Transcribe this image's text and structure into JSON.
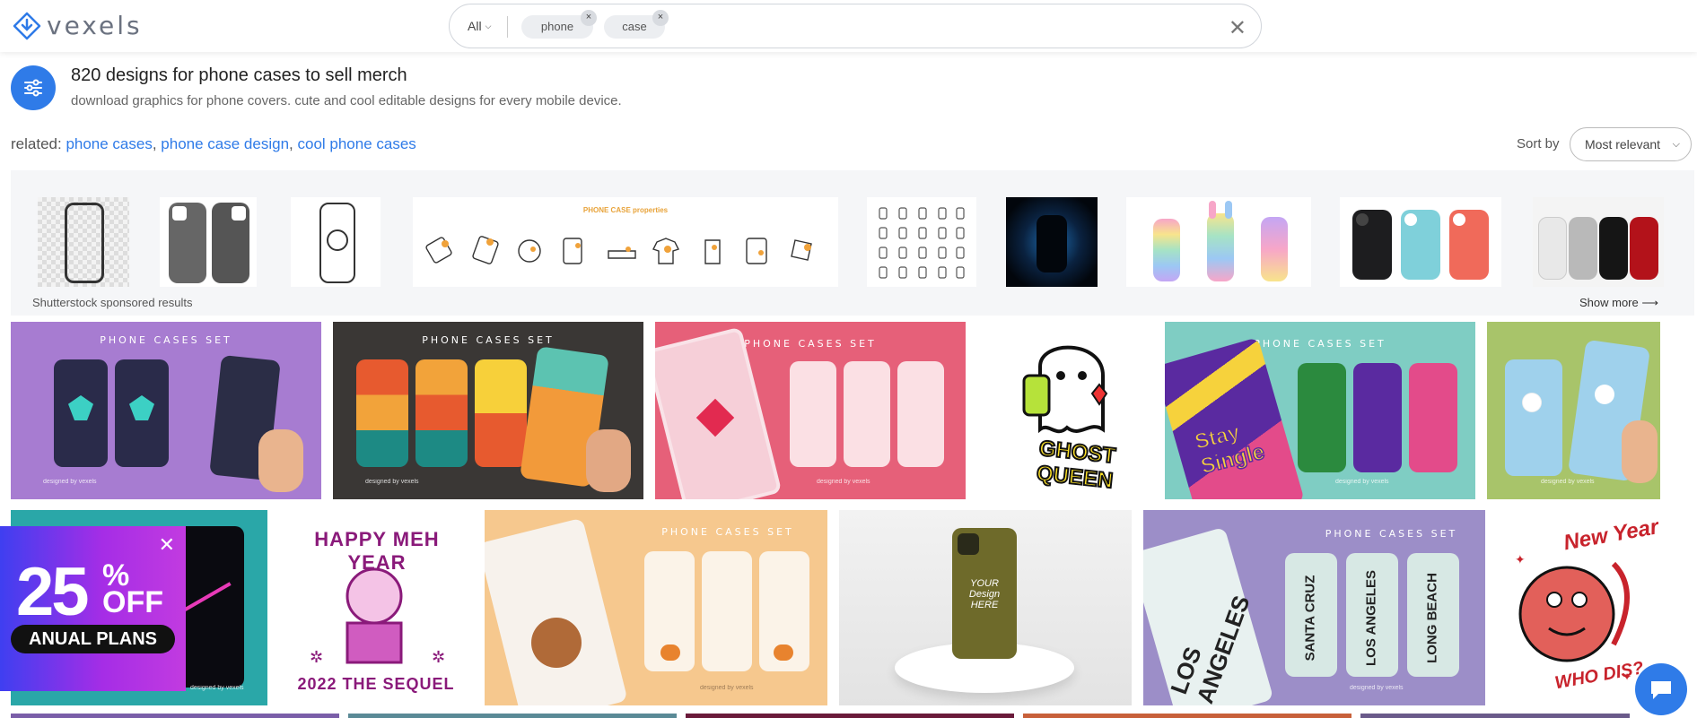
{
  "header": {
    "logo_text": "vexels",
    "search": {
      "scope": "All",
      "chips": [
        "phone",
        "case"
      ],
      "chip_close": "×",
      "clear": "✕"
    }
  },
  "page": {
    "title": "820 designs for phone cases to sell merch",
    "subtitle": "download graphics for phone covers. cute and cool editable designs for every mobile device.",
    "related_label": "related:",
    "related_links": [
      "phone cases",
      "phone case design",
      "cool phone cases"
    ],
    "sort_label": "Sort by",
    "sort_value": "Most relevant"
  },
  "sponsored": {
    "label": "Shutterstock sponsored results",
    "show_more": "Show more",
    "properties_title": "PHONE CASE properties"
  },
  "tiles": {
    "set_title": "PHONE CASES SET",
    "credit": "designed by vexels",
    "ghost_queen": "GHOST QUEEN",
    "stay_single": "Stay Single",
    "happy_meh_year": "HAPPY MEH YEAR",
    "sequel": "2022 THE SEQUEL",
    "your_design": "YOUR Design HERE",
    "santa_cruz": "SANTA CRUZ",
    "los_angeles": "LOS ANGELES",
    "long_beach": "LONG BEACH",
    "new_year": "New Year",
    "who_dis": "WHO DIS?"
  },
  "promo": {
    "big": "25",
    "pct": "%",
    "off": "OFF",
    "pill": "ANUAL PLANS",
    "close": "✕"
  },
  "colors": {
    "accent": "#2f7be8"
  }
}
